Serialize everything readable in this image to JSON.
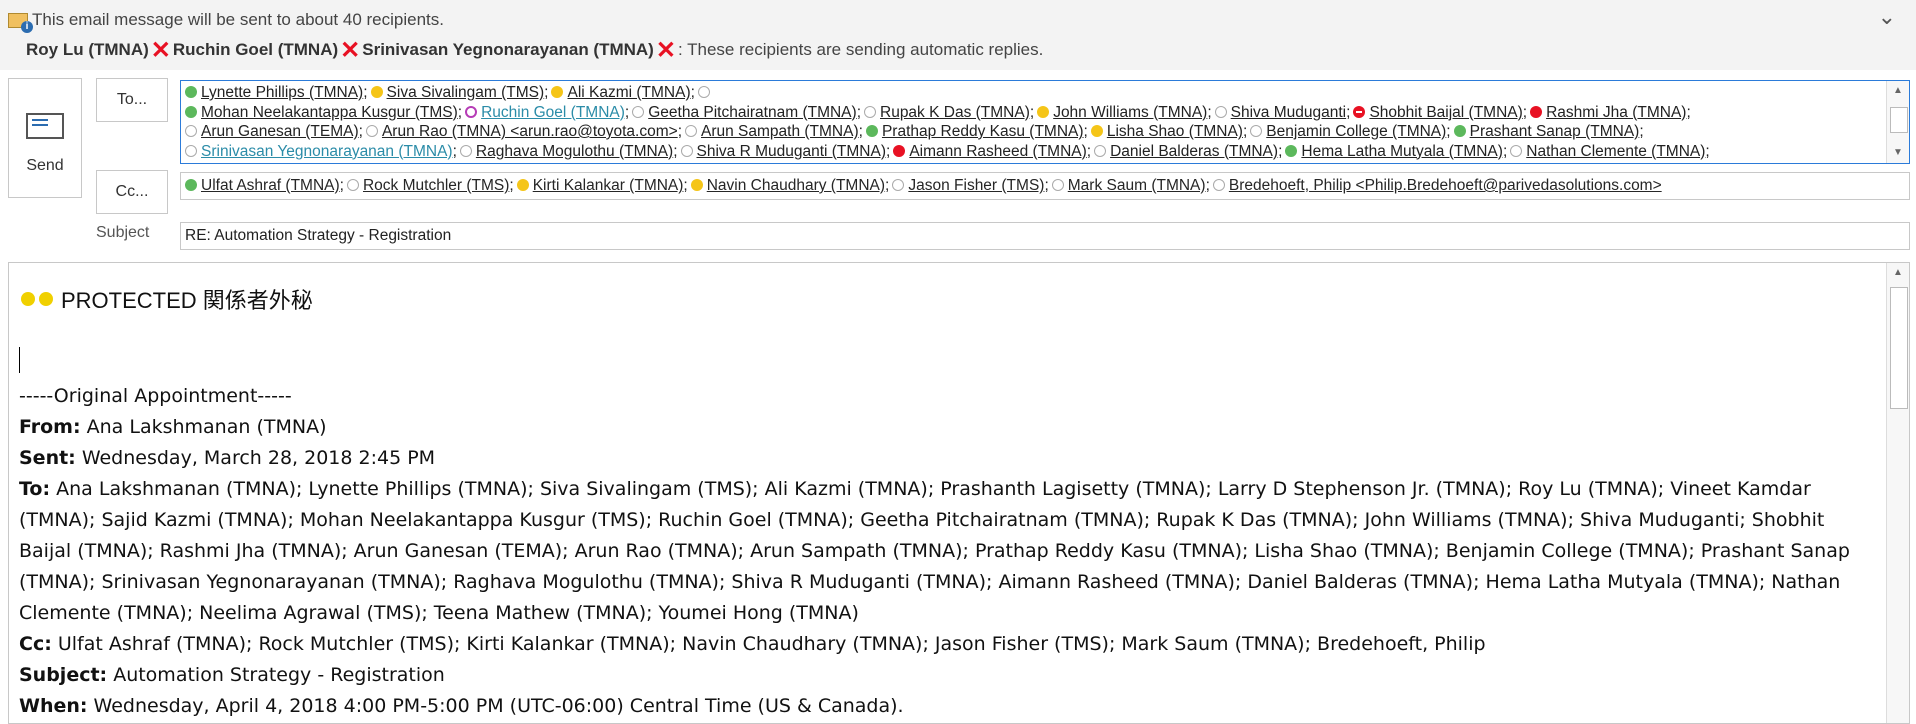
{
  "infobar": {
    "message": "This email message will be sent to about 40 recipients.",
    "auto_reply_names": [
      "Roy Lu (TMNA)",
      "Ruchin Goel (TMNA)",
      "Srinivasan Yegnonarayanan (TMNA)"
    ],
    "auto_reply_text": ": These recipients are sending automatic replies."
  },
  "send_label": "Send",
  "to_label": "To...",
  "cc_label": "Cc...",
  "subject_label": "Subject",
  "to_lines": [
    [
      {
        "name": "Lynette Phillips (TMNA)",
        "status": "available"
      },
      {
        "name": "Siva Sivalingam (TMS)",
        "status": "away"
      },
      {
        "name": "Ali Kazmi (TMNA)",
        "status": "away"
      }
    ],
    [
      {
        "name": "Mohan Neelakantappa Kusgur (TMS)",
        "status": "available"
      },
      {
        "name": "Ruchin Goel (TMNA)",
        "status": "oof"
      },
      {
        "name": "Geetha Pitchairatnam (TMNA)",
        "status": "offline"
      },
      {
        "name": "Rupak K Das (TMNA)",
        "status": "offline"
      },
      {
        "name": "John Williams (TMNA)",
        "status": "away"
      },
      {
        "name": "Shiva Muduganti",
        "status": "offline"
      },
      {
        "name": "Shobhit Baijal (TMNA)",
        "status": "dnd"
      },
      {
        "name": "Rashmi Jha (TMNA)",
        "status": "busy"
      }
    ],
    [
      {
        "name": "Arun Ganesan (TEMA)",
        "status": "offline"
      },
      {
        "name": "Arun Rao (TMNA) <arun.rao@toyota.com>",
        "status": "offline"
      },
      {
        "name": "Arun Sampath (TMNA)",
        "status": "offline"
      },
      {
        "name": "Prathap Reddy Kasu (TMNA)",
        "status": "available"
      },
      {
        "name": "Lisha Shao (TMNA)",
        "status": "away"
      },
      {
        "name": "Benjamin College (TMNA)",
        "status": "offline"
      },
      {
        "name": "Prashant Sanap (TMNA)",
        "status": "available"
      }
    ],
    [
      {
        "name": "Srinivasan Yegnonarayanan (TMNA)",
        "status": "offline"
      },
      {
        "name": "Raghava Mogulothu (TMNA)",
        "status": "offline"
      },
      {
        "name": "Shiva R Muduganti (TMNA)",
        "status": "offline"
      },
      {
        "name": "Aimann Rasheed (TMNA)",
        "status": "busy"
      },
      {
        "name": "Daniel Balderas (TMNA)",
        "status": "offline"
      },
      {
        "name": "Hema Latha Mutyala (TMNA)",
        "status": "available"
      },
      {
        "name": "Nathan Clemente (TMNA)",
        "status": "offline"
      }
    ]
  ],
  "cc_recipients": [
    {
      "name": "Ulfat Ashraf (TMNA)",
      "status": "available"
    },
    {
      "name": "Rock Mutchler (TMS)",
      "status": "offline"
    },
    {
      "name": "Kirti Kalankar (TMNA)",
      "status": "away"
    },
    {
      "name": "Navin Chaudhary (TMNA)",
      "status": "away"
    },
    {
      "name": "Jason Fisher (TMS)",
      "status": "offline"
    },
    {
      "name": "Mark Saum (TMNA)",
      "status": "offline"
    },
    {
      "name": "Bredehoeft, Philip <Philip.Bredehoeft@parivedasolutions.com>",
      "status": "offline"
    }
  ],
  "subject": "RE: Automation Strategy - Registration",
  "body": {
    "classification": "PROTECTED 関係者外秘",
    "original_header": "-----Original Appointment-----",
    "fields": [
      {
        "label": "From:",
        "value": " Ana Lakshmanan (TMNA)"
      },
      {
        "label": "Sent:",
        "value": " Wednesday, March 28, 2018 2:45 PM"
      },
      {
        "label": "To:",
        "value": " Ana Lakshmanan (TMNA); Lynette Phillips (TMNA); Siva Sivalingam (TMS); Ali Kazmi (TMNA); Prashanth Lagisetty (TMNA); Larry D Stephenson Jr. (TMNA); Roy Lu (TMNA); Vineet Kamdar (TMNA); Sajid Kazmi (TMNA); Mohan Neelakantappa Kusgur (TMS); Ruchin Goel (TMNA); Geetha Pitchairatnam (TMNA); Rupak K Das (TMNA); John Williams (TMNA); Shiva Muduganti; Shobhit Baijal (TMNA); Rashmi Jha (TMNA); Arun Ganesan (TEMA); Arun Rao (TMNA); Arun Sampath (TMNA); Prathap Reddy Kasu (TMNA); Lisha Shao (TMNA); Benjamin College (TMNA); Prashant Sanap (TMNA); Srinivasan Yegnonarayanan (TMNA); Raghava Mogulothu (TMNA); Shiva R Muduganti (TMNA); Aimann Rasheed (TMNA); Daniel Balderas (TMNA); Hema Latha Mutyala (TMNA); Nathan Clemente (TMNA); Neelima Agrawal (TMS); Teena Mathew (TMNA); Youmei Hong (TMNA)"
      },
      {
        "label": "Cc:",
        "value": " Ulfat Ashraf (TMNA); Rock Mutchler (TMS); Kirti Kalankar (TMNA); Navin Chaudhary (TMNA); Jason Fisher (TMS); Mark Saum (TMNA); Bredehoeft, Philip"
      },
      {
        "label": "Subject:",
        "value": " Automation Strategy - Registration"
      },
      {
        "label": "When:",
        "value": " Wednesday, April 4, 2018 4:00 PM-5:00 PM (UTC-06:00) Central Time (US & Canada)."
      }
    ]
  }
}
